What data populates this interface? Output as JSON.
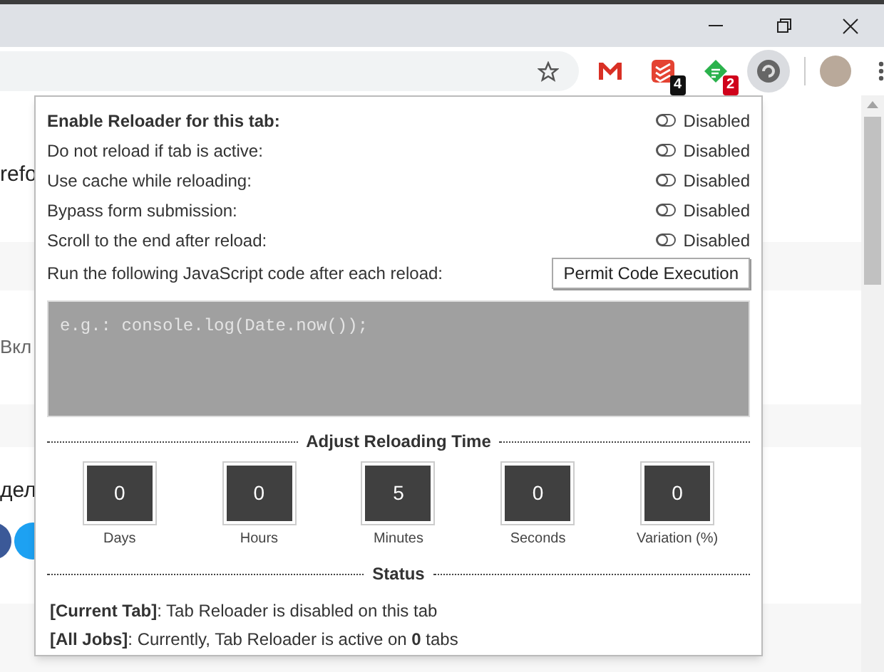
{
  "toolbar": {
    "extensions": [
      {
        "kind": "mail"
      },
      {
        "kind": "todo",
        "badge": "4",
        "color": "#111111"
      },
      {
        "kind": "feed",
        "badge": "2",
        "color": "#d0021b"
      },
      {
        "kind": "reload",
        "selected": true
      }
    ]
  },
  "page": {
    "fragments": [
      "refo",
      "Вкл",
      "дел"
    ]
  },
  "popup": {
    "options": [
      {
        "label": "Enable Reloader for this tab:",
        "on": false,
        "state": "Disabled"
      },
      {
        "label": "Do not reload if tab is active:",
        "on": false,
        "state": "Disabled"
      },
      {
        "label": "Use cache while reloading:",
        "on": false,
        "state": "Disabled"
      },
      {
        "label": "Bypass form submission:",
        "on": false,
        "state": "Disabled"
      },
      {
        "label": "Scroll to the end after reload:",
        "on": false,
        "state": "Disabled"
      }
    ],
    "code": {
      "label": "Run the following JavaScript code after each reload:",
      "button": "Permit Code Execution",
      "placeholder": "e.g.: console.log(Date.now());"
    },
    "timing": {
      "title": "Adjust Reloading Time",
      "fields": [
        {
          "value": "0",
          "label": "Days"
        },
        {
          "value": "0",
          "label": "Hours"
        },
        {
          "value": "5",
          "label": "Minutes"
        },
        {
          "value": "0",
          "label": "Seconds"
        },
        {
          "value": "0",
          "label": "Variation (%)"
        }
      ]
    },
    "status": {
      "title": "Status",
      "lines": [
        "**[Current Tab]**: Tab Reloader is disabled on this tab",
        "**[All Jobs]**: Currently, Tab Reloader is active on **0** tabs"
      ]
    }
  }
}
